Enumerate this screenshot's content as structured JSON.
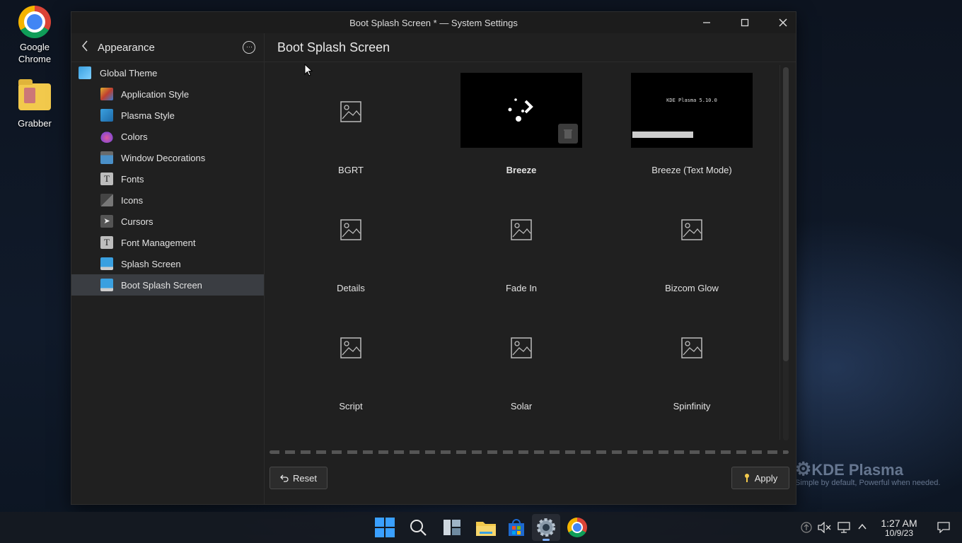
{
  "desktop": {
    "icons": [
      {
        "label": "Google Chrome"
      },
      {
        "label": "Grabber"
      }
    ],
    "watermark": {
      "brand": "KDE Plasma",
      "tagline": "Simple by default, Powerful when  needed."
    }
  },
  "window": {
    "title": "Boot Splash Screen * — System Settings",
    "controls": {
      "minimize": "–",
      "maximize": "□",
      "close": "✕"
    }
  },
  "sidebar": {
    "header": "Appearance",
    "items": [
      {
        "label": "Global Theme",
        "icon": "global-theme-icon",
        "color": "#3aa0e0",
        "level": "top"
      },
      {
        "label": "Application Style",
        "icon": "application-style-icon",
        "color": "#c9a227",
        "level": "sub"
      },
      {
        "label": "Plasma Style",
        "icon": "plasma-style-icon",
        "color": "#3aa0e0",
        "level": "sub"
      },
      {
        "label": "Colors",
        "icon": "colors-icon",
        "color": "#e05a9a",
        "level": "sub"
      },
      {
        "label": "Window Decorations",
        "icon": "window-decorations-icon",
        "color": "#4a90c8",
        "level": "sub"
      },
      {
        "label": "Fonts",
        "icon": "fonts-icon",
        "color": "#bdbdbd",
        "level": "sub"
      },
      {
        "label": "Icons",
        "icon": "icons-icon",
        "color": "#7a7a7a",
        "level": "sub"
      },
      {
        "label": "Cursors",
        "icon": "cursors-icon",
        "color": "#6a6a6a",
        "level": "sub"
      },
      {
        "label": "Font Management",
        "icon": "font-management-icon",
        "color": "#bdbdbd",
        "level": "sub"
      },
      {
        "label": "Splash Screen",
        "icon": "splash-screen-icon",
        "color": "#3aa0e0",
        "level": "sub"
      },
      {
        "label": "Boot Splash Screen",
        "icon": "boot-splash-screen-icon",
        "color": "#3aa0e0",
        "level": "sub",
        "active": true
      }
    ]
  },
  "main": {
    "title": "Boot Splash Screen",
    "themes": [
      {
        "label": "BGRT",
        "preview": "placeholder"
      },
      {
        "label": "Breeze",
        "preview": "breeze",
        "selected": true
      },
      {
        "label": "Breeze (Text Mode)",
        "preview": "text-mode",
        "preview_text": "KDE Plasma 5.10.0"
      },
      {
        "label": "Details",
        "preview": "placeholder"
      },
      {
        "label": "Fade In",
        "preview": "placeholder"
      },
      {
        "label": "Bizcom Glow",
        "preview": "placeholder"
      },
      {
        "label": "Script",
        "preview": "placeholder"
      },
      {
        "label": "Solar",
        "preview": "placeholder"
      },
      {
        "label": "Spinfinity",
        "preview": "placeholder"
      }
    ],
    "buttons": {
      "reset": "Reset",
      "apply": "Apply"
    }
  },
  "taskbar": {
    "apps": [
      "start-icon",
      "search-icon",
      "task-view-icon",
      "file-explorer-icon",
      "store-icon",
      "system-settings-icon",
      "chrome-icon"
    ],
    "clock": {
      "time": "1:27 AM",
      "date": "10/9/23"
    }
  }
}
